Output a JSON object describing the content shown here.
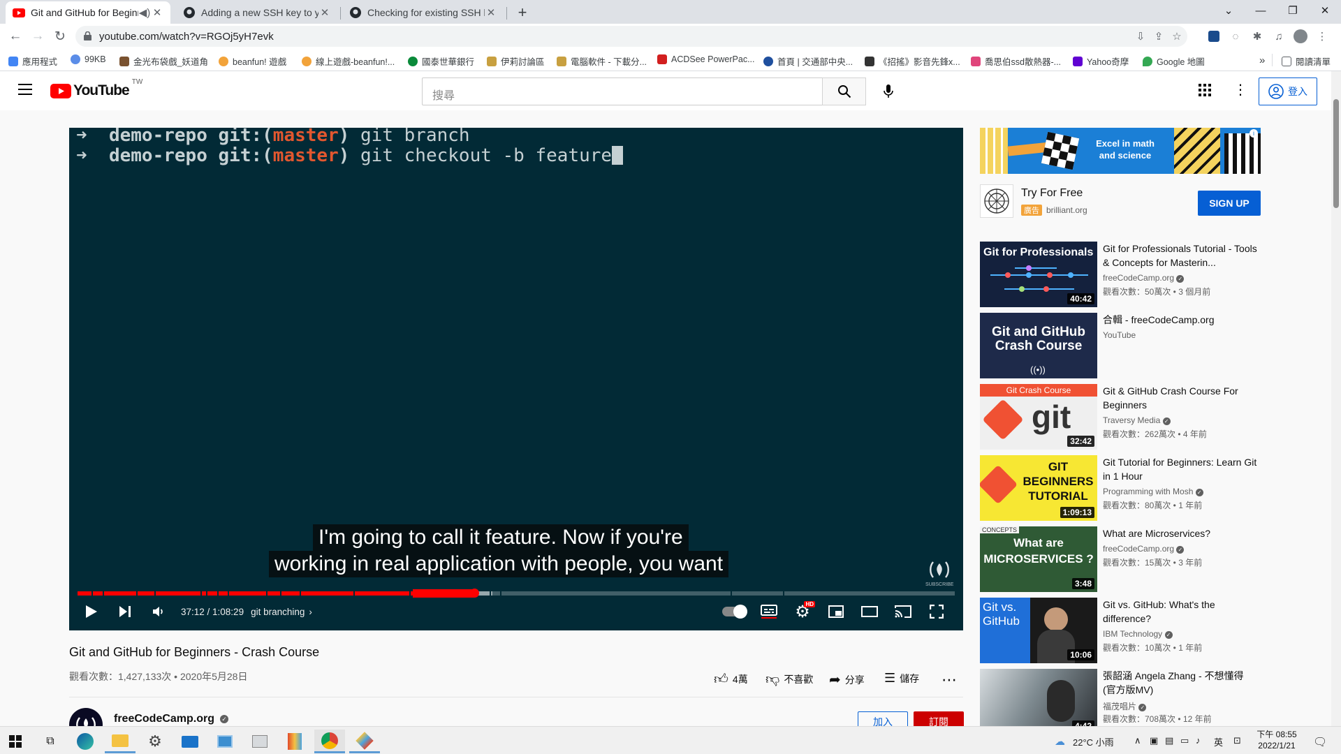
{
  "browser": {
    "tabs": [
      {
        "title": "Git and GitHub for Beginne",
        "active": true
      },
      {
        "title": "Adding a new SSH key to your",
        "active": false
      },
      {
        "title": "Checking for existing SSH keys",
        "active": false
      }
    ],
    "new_tab": "+",
    "url": "youtube.com/watch?v=RGOj5yH7evk",
    "bookmarks": [
      {
        "label": "應用程式",
        "color": "#4285f4"
      },
      {
        "label": "99KB",
        "color": "#5b8de8"
      },
      {
        "label": "金光布袋戲_妖道角",
        "color": "#7a5230"
      },
      {
        "label": "beanfun! 遊戲",
        "color": "#f2a33a"
      },
      {
        "label": "線上遊戲-beanfun!...",
        "color": "#f2a33a"
      },
      {
        "label": "國泰世華銀行",
        "color": "#0a8a3a"
      },
      {
        "label": "伊莉討論區",
        "color": "#c8a040"
      },
      {
        "label": "電腦軟件 - 下載分...",
        "color": "#c8a040"
      },
      {
        "label": "ACDSee PowerPac...",
        "color": "#d21f1f"
      },
      {
        "label": "首頁 | 交通部中央...",
        "color": "#1f4f9e"
      },
      {
        "label": "《招搖》影音先鋒x...",
        "color": "#333333"
      },
      {
        "label": "喬思伯ssd散熱器-...",
        "color": "#e0457b"
      },
      {
        "label": "Yahoo奇摩",
        "color": "#6001d2"
      },
      {
        "label": "Google 地圖",
        "color": "#34a853"
      }
    ],
    "more_bookmarks": "»",
    "reading_list": "閱讀清單"
  },
  "youtube": {
    "logo_text": "YouTube",
    "region": "TW",
    "search_placeholder": "搜尋",
    "signin_label": "登入"
  },
  "player": {
    "terminal_lines": [
      {
        "arrow": "➜",
        "dir": "demo-repo",
        "git": "git:(",
        "branch": "master",
        "close": ")",
        "cmd": "git branch"
      },
      {
        "arrow": "➜",
        "dir": "demo-repo",
        "git": "git:(",
        "branch": "master",
        "close": ")",
        "cmd": "git checkout -b feature"
      }
    ],
    "captions": [
      "I'm going to call it feature. Now if you're",
      "working in real application with people, you want"
    ],
    "time": "37:12 / 1:08:29",
    "chapter": "git branching",
    "progress": {
      "played_fraction": 0.452,
      "buffered_fraction": 0.473
    },
    "watermark_label": "SUBSCRIBE",
    "settings_badge": "HD"
  },
  "video": {
    "title": "Git and GitHub for Beginners - Crash Course",
    "meta": "觀看次數：1,427,133次 • 2020年5月28日",
    "actions": {
      "like": "4萬",
      "dislike": "不喜歡",
      "share": "分享",
      "save": "儲存"
    },
    "channel": "freeCodeCamp.org",
    "join": "加入",
    "subscribe": "訂閱"
  },
  "ad": {
    "banner_text": "Excel in math and science",
    "title": "Try For Free",
    "badge": "廣告",
    "domain": "brilliant.org",
    "cta": "SIGN UP"
  },
  "recommendations": [
    {
      "title": "Git for Professionals Tutorial - Tools & Concepts for Masterin...",
      "channel": "freeCodeCamp.org",
      "meta": "觀看次數：50萬次 • 3 個月前",
      "duration": "40:42",
      "thumb_text": "Git for Professionals",
      "verified": true
    },
    {
      "title": "合輯 - freeCodeCamp.org",
      "channel": "YouTube",
      "meta": "",
      "duration": "",
      "thumb_text": "Git and GitHub Crash Course",
      "verified": false
    },
    {
      "title": "Git & GitHub Crash Course For Beginners",
      "channel": "Traversy Media",
      "meta": "觀看次數：262萬次 • 4 年前",
      "duration": "32:42",
      "thumb_text": "git",
      "thumb_banner": "Git Crash Course",
      "verified": true
    },
    {
      "title": "Git Tutorial for Beginners: Learn Git in 1 Hour",
      "channel": "Programming with Mosh",
      "meta": "觀看次數：80萬次 • 1 年前",
      "duration": "1:09:13",
      "thumb_text": "GIT BEGINNERS TUTORIAL",
      "verified": true
    },
    {
      "title": "What are Microservices?",
      "channel": "freeCodeCamp.org",
      "meta": "觀看次數：15萬次 • 3 年前",
      "duration": "3:48",
      "thumb_text": "What are MICROSERVICES ?",
      "thumb_banner": "CONCEPTS",
      "verified": true
    },
    {
      "title": "Git vs. GitHub: What's the difference?",
      "channel": "IBM Technology",
      "meta": "觀看次數：10萬次 • 1 年前",
      "duration": "10:06",
      "thumb_text": "Git vs. GitHub",
      "verified": true
    },
    {
      "title": "張韶涵 Angela Zhang - 不想懂得 (官方版MV)",
      "channel": "福茂唱片",
      "meta": "觀看次數：708萬次 • 12 年前",
      "duration": "4:42",
      "thumb_text": "",
      "verified": true
    }
  ],
  "taskbar": {
    "weather": "22°C 小雨",
    "ime": "英",
    "time": "下午 08:55",
    "date": "2022/1/21"
  }
}
